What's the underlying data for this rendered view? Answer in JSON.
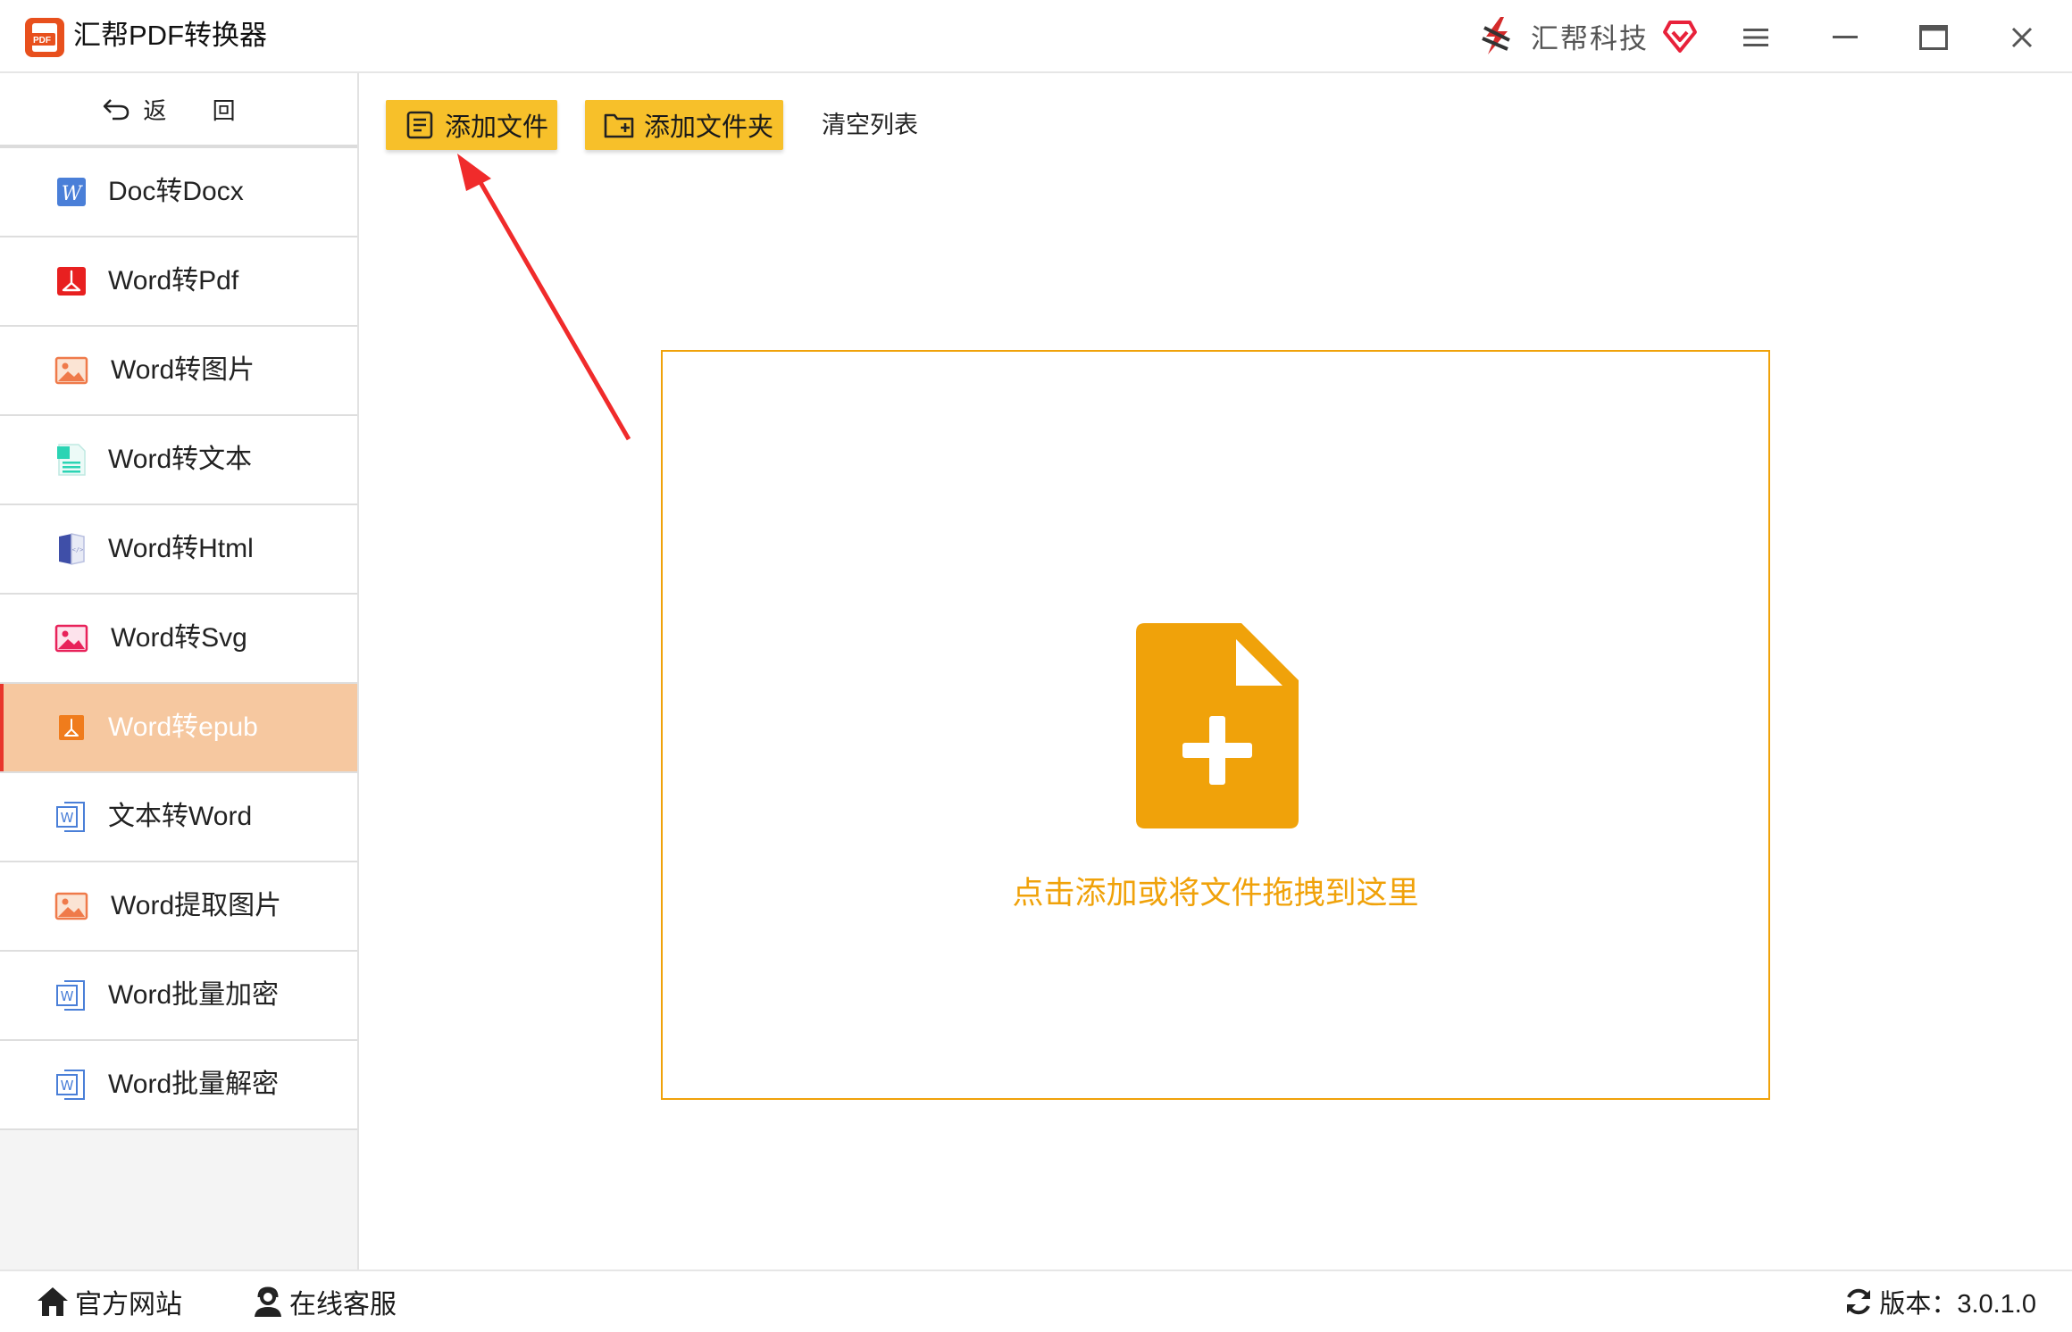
{
  "window": {
    "title": "汇帮PDF转换器",
    "brand": "汇帮科技"
  },
  "sidebar": {
    "back_label": "返 回",
    "items": [
      {
        "label": "Doc转Docx",
        "icon": "word-w-icon",
        "active": false
      },
      {
        "label": "Word转Pdf",
        "icon": "pdf-icon",
        "active": false
      },
      {
        "label": "Word转图片",
        "icon": "image-icon",
        "active": false
      },
      {
        "label": "Word转文本",
        "icon": "text-doc-icon",
        "active": false
      },
      {
        "label": "Word转Html",
        "icon": "html-book-icon",
        "active": false
      },
      {
        "label": "Word转Svg",
        "icon": "svg-image-icon",
        "active": false
      },
      {
        "label": "Word转epub",
        "icon": "epub-icon",
        "active": true
      },
      {
        "label": "文本转Word",
        "icon": "word-doc-icon",
        "active": false
      },
      {
        "label": "Word提取图片",
        "icon": "image-icon",
        "active": false
      },
      {
        "label": "Word批量加密",
        "icon": "word-doc-icon",
        "active": false
      },
      {
        "label": "Word批量解密",
        "icon": "word-doc-icon",
        "active": false
      }
    ]
  },
  "toolbar": {
    "add_file": "添加文件",
    "add_folder": "添加文件夹",
    "clear_list": "清空列表"
  },
  "dropzone": {
    "hint": "点击添加或将文件拖拽到这里"
  },
  "footer": {
    "website": "官方网站",
    "support": "在线客服",
    "version": "版本：3.0.1.0"
  },
  "colors": {
    "accent_yellow": "#f7c02a",
    "drop_orange": "#f0a20a",
    "active_item": "#f6c8a0",
    "active_marker": "#e8362b"
  }
}
